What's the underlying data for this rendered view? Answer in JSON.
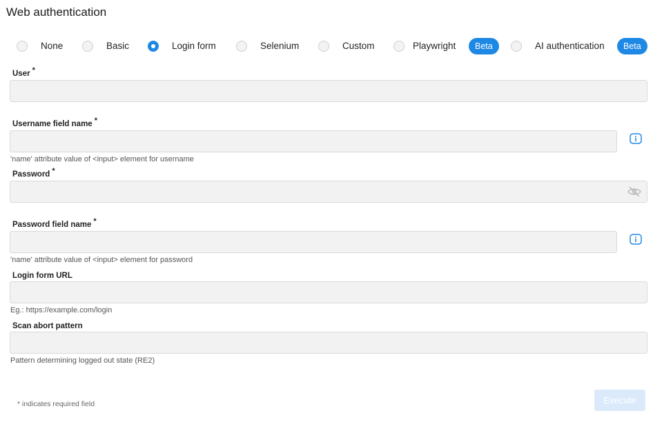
{
  "title": "Web authentication",
  "auth_options": [
    {
      "label": "None",
      "checked": false
    },
    {
      "label": "Basic",
      "checked": false
    },
    {
      "label": "Login form",
      "checked": true
    },
    {
      "label": "Selenium",
      "checked": false
    },
    {
      "label": "Custom",
      "checked": false
    },
    {
      "label": "Playwright",
      "checked": false,
      "badge": "Beta"
    },
    {
      "label": "AI authentication",
      "checked": false,
      "badge": "Beta"
    }
  ],
  "required_mark": "*",
  "fields": {
    "user": {
      "label": "User",
      "value": ""
    },
    "username_field": {
      "label": "Username field name",
      "value": "",
      "hint": "'name' attribute value of <input> element for username",
      "icon": "info-icon"
    },
    "password": {
      "label": "Password",
      "value": "",
      "icon": "eye-off-icon"
    },
    "password_field": {
      "label": "Password field name",
      "value": "",
      "hint": "'name' attribute value of <input> element for password",
      "icon": "info-icon"
    },
    "login_url": {
      "label": "Login form URL",
      "value": "",
      "hint": "Eg.: https://example.com/login"
    },
    "scan_abort": {
      "label": "Scan abort pattern",
      "value": "",
      "hint": "Pattern determining logged out state (RE2)"
    }
  },
  "footnote": "* indicates required field",
  "execute_label": "Execute",
  "colors": {
    "accent": "#1e88e5",
    "input_bg": "#f2f2f2",
    "execute_disabled_bg": "#dbeafb"
  }
}
